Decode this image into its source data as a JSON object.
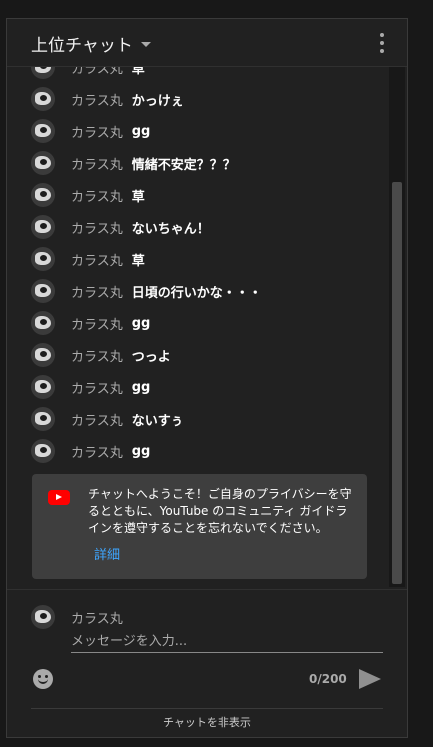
{
  "header": {
    "title": "上位チャット"
  },
  "messages": [
    {
      "author": "カラス丸",
      "text": "草"
    },
    {
      "author": "カラス丸",
      "text": "かっけぇ"
    },
    {
      "author": "カラス丸",
      "text": "gg"
    },
    {
      "author": "カラス丸",
      "text": "情緒不安定？？？"
    },
    {
      "author": "カラス丸",
      "text": "草"
    },
    {
      "author": "カラス丸",
      "text": "ないちゃん！"
    },
    {
      "author": "カラス丸",
      "text": "草"
    },
    {
      "author": "カラス丸",
      "text": "日頃の行いかな・・・"
    },
    {
      "author": "カラス丸",
      "text": "gg"
    },
    {
      "author": "カラス丸",
      "text": "つっよ"
    },
    {
      "author": "カラス丸",
      "text": "gg"
    },
    {
      "author": "カラス丸",
      "text": "ないすぅ"
    },
    {
      "author": "カラス丸",
      "text": "gg"
    }
  ],
  "welcome": {
    "text": "チャットへようこそ！ご自身のプライバシーを守るとともに、YouTube のコミュニティ ガイドラインを遵守することを忘れないでください。",
    "link": "詳細"
  },
  "composer": {
    "author": "カラス丸",
    "placeholder": "メッセージを入力...",
    "counter": "0/200"
  },
  "footer": {
    "hide_chat": "チャットを非表示"
  },
  "colors": {
    "accent_link": "#3ea6ff",
    "youtube_red": "#ff0000"
  },
  "icons": [
    "dropdown-caret-icon",
    "more-vert-icon",
    "youtube-icon",
    "emoji-icon",
    "send-icon"
  ]
}
